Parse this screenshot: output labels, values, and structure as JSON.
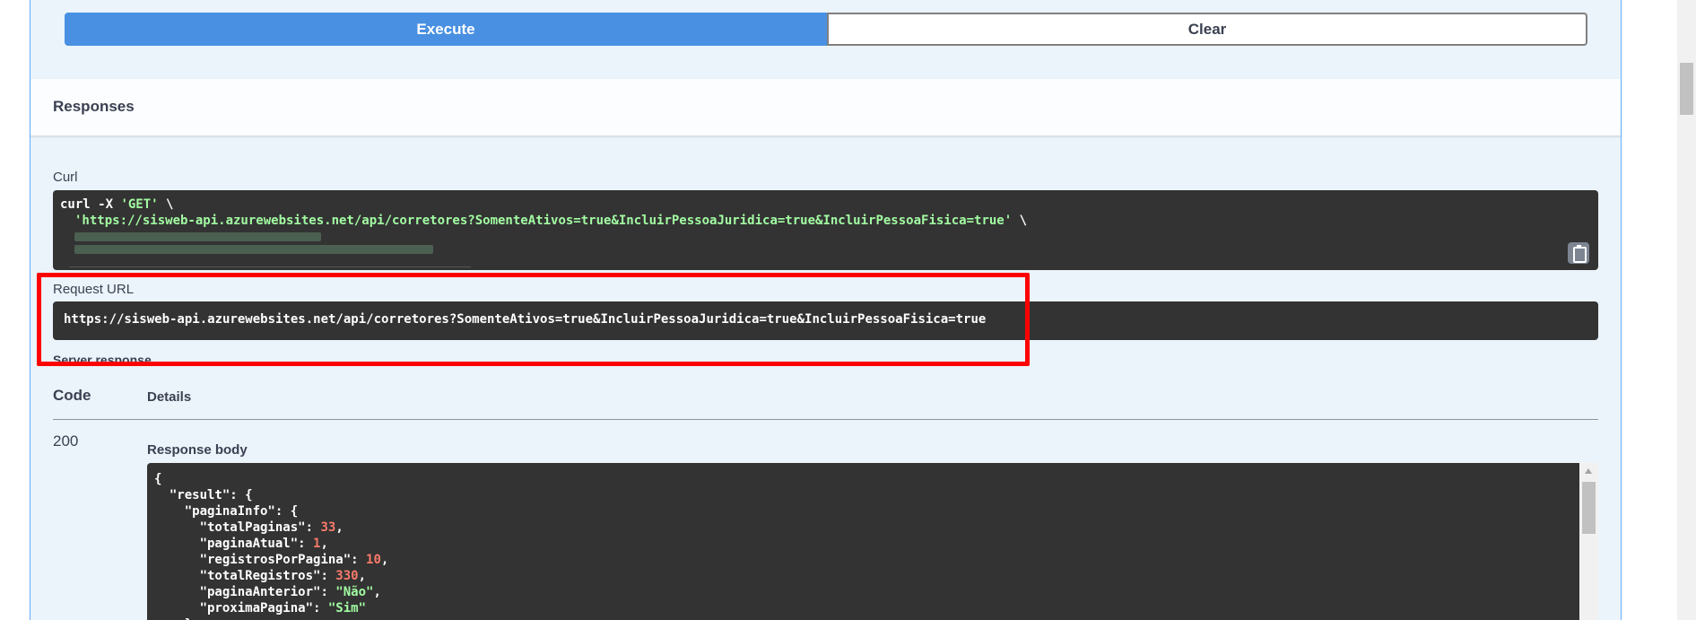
{
  "buttons": {
    "execute": "Execute",
    "clear": "Clear"
  },
  "responses": {
    "title": "Responses"
  },
  "curl": {
    "label": "Curl",
    "line1_cmd": "curl -X ",
    "line1_method": "'GET'",
    "line1_end": " \\",
    "line2_url": "'https://sisweb-api.azurewebsites.net/api/corretores?SomenteAtivos=true&IncluirPessoaJuridica=true&IncluirPessoaFisica=true'",
    "line2_end": " \\"
  },
  "request_url": {
    "label": "Request URL",
    "value": "https://sisweb-api.azurewebsites.net/api/corretores?SomenteAtivos=true&IncluirPessoaJuridica=true&IncluirPessoaFisica=true"
  },
  "server_response": {
    "label": "Server response",
    "col_code": "Code",
    "col_details": "Details",
    "status_code": "200",
    "body_label": "Response body",
    "body": {
      "open_brace": "{",
      "result_key": "\"result\"",
      "pagina_info_key": "\"paginaInfo\"",
      "total_paginas_key": "\"totalPaginas\"",
      "total_paginas_val": "33",
      "pagina_atual_key": "\"paginaAtual\"",
      "pagina_atual_val": "1",
      "registros_por_pagina_key": "\"registrosPorPagina\"",
      "registros_por_pagina_val": "10",
      "total_registros_key": "\"totalRegistros\"",
      "total_registros_val": "330",
      "pagina_anterior_key": "\"paginaAnterior\"",
      "pagina_anterior_val": "\"Não\"",
      "proxima_pagina_key": "\"proximaPagina\"",
      "proxima_pagina_val": "\"Sim\"",
      "close_info": "},"
    }
  },
  "icons": {
    "copy": "clipboard-icon"
  },
  "colors": {
    "execute_bg": "#4990e2",
    "code_bg": "#333333",
    "highlight": "#ff0000",
    "json_number": "#f87a6a",
    "json_string": "#a2fca2",
    "panel_bg": "#ebf3fb"
  }
}
